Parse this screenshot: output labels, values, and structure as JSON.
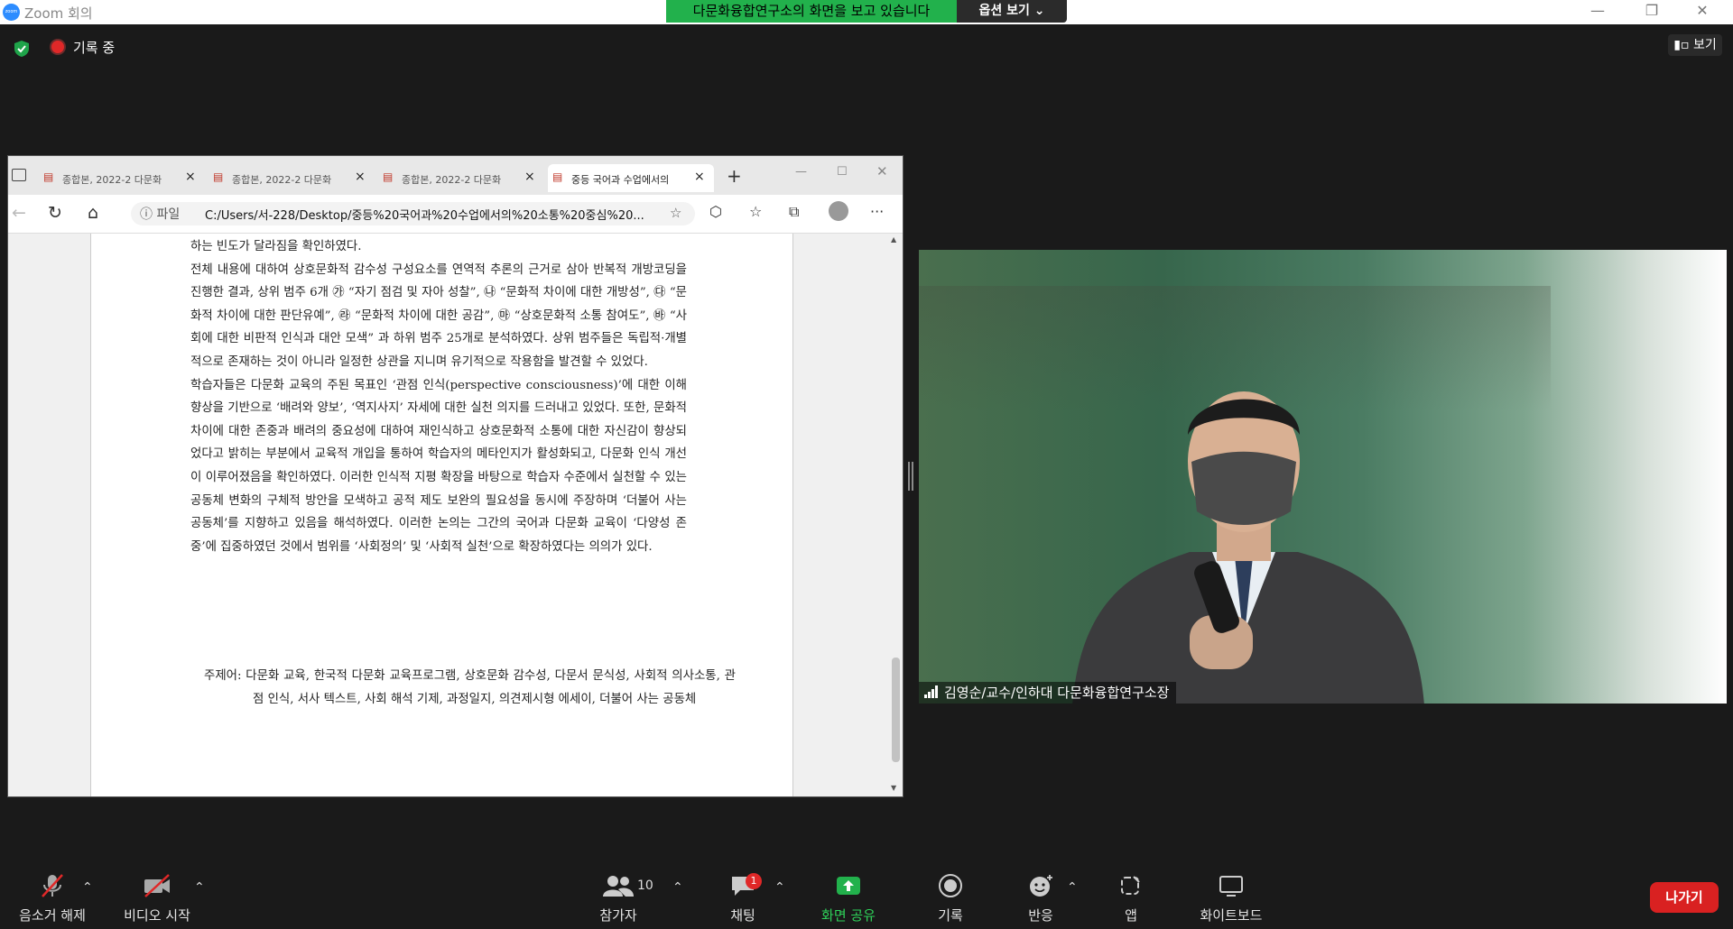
{
  "app": {
    "title": "Zoom 회의",
    "logo_text": "zoom"
  },
  "share_banner": {
    "text": "다문화융합연구소의 화면을 보고 있습니다",
    "options_label": "옵션 보기 ⌄"
  },
  "window_controls": {
    "minimize": "—",
    "restore": "❐",
    "close": "✕"
  },
  "meeting_status": {
    "recording_label": "기록 중",
    "view_label": "보기"
  },
  "browser": {
    "tabs": [
      {
        "label": "종합본, 2022-2 다문화"
      },
      {
        "label": "종합본, 2022-2 다문화"
      },
      {
        "label": "종합본, 2022-2 다문화"
      },
      {
        "label": "중등 국어과 수업에서의"
      }
    ],
    "new_tab": "+",
    "file_label": "파일",
    "url": "C:/Users/서-228/Desktop/중등%20국어과%20수업에서의%20소통%20중심%20...",
    "window_controls": {
      "minimize": "—",
      "restore": "☐",
      "close": "✕"
    }
  },
  "document": {
    "paragraphs": [
      "하는 빈도가 달라짐을 확인하였다.",
      "  전체 내용에 대하여 상호문화적 감수성 구성요소를 연역적 추론의 근거로 삼아 반복적 개방코딩을 진행한 결과, 상위 범주 6개 ㉮ “자기 점검 및 자아 성찰”, ㉯ “문화적 차이에 대한 개방성”, ㉰ “문화적 차이에 대한 판단유예”, ㉱ “문화적 차이에 대한 공감”, ㉲ “상호문화적 소통 참여도”, ㉳ “사회에 대한 비판적 인식과 대안 모색” 과 하위 범주 25개로 분석하였다. 상위 범주들은 독립적·개별적으로 존재하는 것이 아니라 일정한 상관을 지니며 유기적으로 작용함을 발견할 수 있었다.",
      "  학습자들은 다문화 교육의 주된 목표인 ‘관점 인식(perspective consciousness)’에 대한 이해 향상을 기반으로 ‘배려와 양보’, ‘역지사지’ 자세에 대한 실천 의지를 드러내고 있었다. 또한, 문화적 차이에 대한 존중과 배려의 중요성에 대하여 재인식하고 상호문화적 소통에 대한 자신감이 향상되었다고 밝히는 부분에서 교육적 개입을 통하여 학습자의 메타인지가 활성화되고, 다문화 인식 개선이 이루어졌음을 확인하였다. 이러한 인식적 지평 확장을 바탕으로 학습자 수준에서 실천할 수 있는 공동체 변화의 구체적 방안을 모색하고 공적 제도 보완의 필요성을 동시에 주장하며 ‘더불어 사는 공동체’를 지향하고 있음을 해석하였다. 이러한 논의는 그간의 국어과 다문화 교육이 ‘다양성 존중’에 집중하였던 것에서 범위를 ‘사회정의’ 및 ‘사회적 실천’으로 확장하였다는 의의가 있다."
    ],
    "keywords": "주제어: 다문화 교육, 한국적 다문화 교육프로그램, 상호문화 감수성, 다문서 문식성, 사회적 의사소통, 관점 인식, 서사 텍스트, 사회 해석 기제, 과정일지, 의견제시형 에세이, 더불어 사는 공동체"
  },
  "video": {
    "participant_name": "김영순/교수/인하대 다문화융합연구소장"
  },
  "toolbar": {
    "unmute": "음소거 해제",
    "start_video": "비디오 시작",
    "participants": "참가자",
    "participants_count": "10",
    "chat": "채팅",
    "chat_badge": "1",
    "share_screen": "화면 공유",
    "record": "기록",
    "reactions": "반응",
    "apps": "앱",
    "whiteboard": "화이트보드",
    "leave": "나가기",
    "caret": "⌃"
  },
  "colors": {
    "share_green": "#22b14c",
    "leave_red": "#d92121",
    "record_red": "#e02828"
  }
}
